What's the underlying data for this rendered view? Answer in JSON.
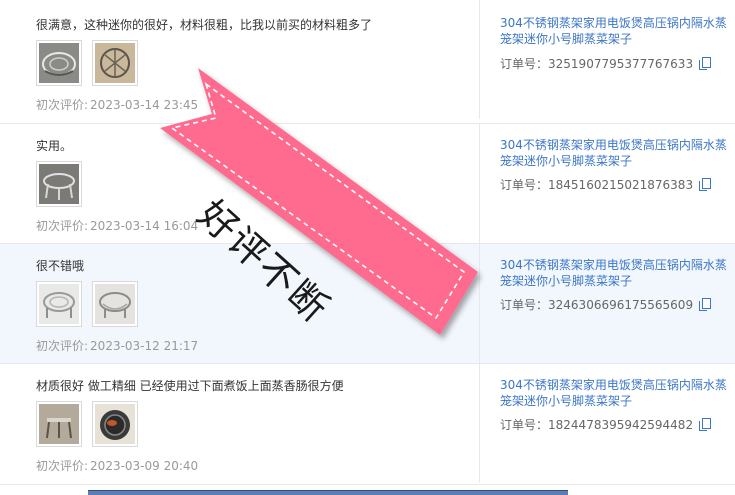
{
  "reviews": [
    {
      "text": "很满意，这种迷你的很好，材料很粗，比我以前买的材料粗多了",
      "date_label": "初次评价:",
      "date": "2023-03-14 23:45",
      "product_title": "304不锈钢蒸架家用电饭煲高压锅内隔水蒸笼架迷你小号脚蒸菜架子",
      "order_label": "订单号：",
      "order_no": "3251907795377767633"
    },
    {
      "text": "实用。",
      "date_label": "初次评价:",
      "date": "2023-03-14 16:04",
      "product_title": "304不锈钢蒸架家用电饭煲高压锅内隔水蒸笼架迷你小号脚蒸菜架子",
      "order_label": "订单号：",
      "order_no": "1845160215021876383"
    },
    {
      "text": "很不错哦",
      "date_label": "初次评价:",
      "date": "2023-03-12 21:17",
      "product_title": "304不锈钢蒸架家用电饭煲高压锅内隔水蒸笼架迷你小号脚蒸菜架子",
      "order_label": "订单号：",
      "order_no": "3246306696175565609"
    },
    {
      "text": "材质很好 做工精细 已经使用过下面煮饭上面蒸香肠很方便",
      "date_label": "初次评价:",
      "date": "2023-03-09 20:40",
      "product_title": "304不锈钢蒸架家用电饭煲高压锅内隔水蒸笼架迷你小号脚蒸菜架子",
      "order_label": "订单号：",
      "order_no": "1824478395942594482"
    }
  ],
  "banner": {
    "text": "好评不断",
    "color": "#ff6b8f"
  },
  "colors": {
    "link": "#3c76c6",
    "highlight_row": "#f2f7fd"
  }
}
